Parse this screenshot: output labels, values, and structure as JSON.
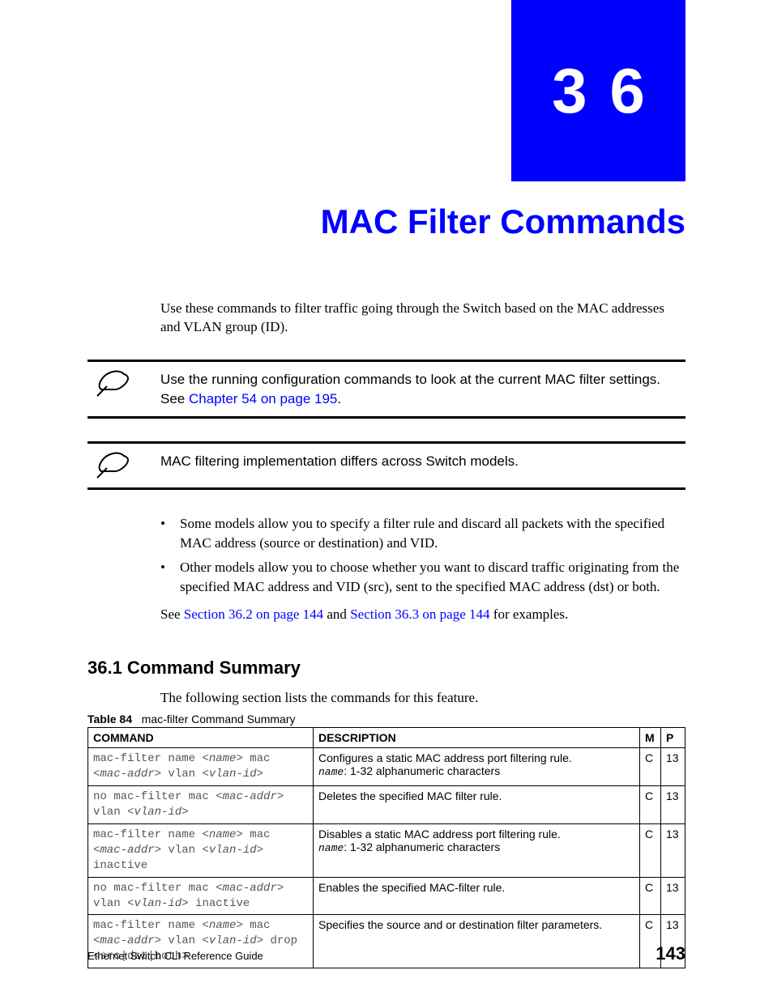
{
  "chapter": {
    "number": "36",
    "title": "MAC Filter Commands"
  },
  "intro": "Use these commands to filter traffic going through the Switch based on the MAC addresses and VLAN group (ID).",
  "note1": {
    "text_before_link": "Use the running configuration commands to look at the current MAC filter settings. See ",
    "link": "Chapter 54 on page 195",
    "text_after_link": "."
  },
  "note2": {
    "text": "MAC filtering implementation differs across Switch models."
  },
  "bullets": [
    "Some models allow you to specify a filter rule and discard all packets with the specified MAC address (source or destination) and VID.",
    "Other models allow you to choose whether you want to discard traffic originating from the specified MAC address and VID (src), sent to the specified MAC address (dst) or both."
  ],
  "see": {
    "pre": "See ",
    "link1": "Section 36.2 on page 144",
    "mid": " and ",
    "link2": "Section 36.3 on page 144",
    "post": " for examples."
  },
  "section": {
    "heading": "36.1  Command Summary",
    "lead": "The following section lists the commands for this feature."
  },
  "table": {
    "caption_label": "Table 84",
    "caption_text": "mac-filter Command Summary",
    "headers": {
      "c1": "COMMAND",
      "c2": "DESCRIPTION",
      "c3": "M",
      "c4": "P"
    },
    "rows": [
      {
        "cmd_html": "mac-filter name <<i>name</i>> mac <<i>mac-addr</i>> vlan <<i>vlan-id</i>>",
        "desc_html": "Configures a static MAC address port filtering rule.<br><span class=\"desc-name\">name</span>: 1-32 alphanumeric characters",
        "m": "C",
        "p": "13"
      },
      {
        "cmd_html": "no mac-filter mac <<i>mac-addr</i>> vlan <<i>vlan-id</i>>",
        "desc_html": "Deletes the specified MAC filter rule.",
        "m": "C",
        "p": "13"
      },
      {
        "cmd_html": "mac-filter name <<i>name</i>> mac <<i>mac-addr</i>> vlan <<i>vlan-id</i>> inactive",
        "desc_html": "Disables a static MAC address port filtering rule.<br><span class=\"desc-name\">name</span>: 1-32 alphanumeric characters",
        "m": "C",
        "p": "13"
      },
      {
        "cmd_html": "no mac-filter mac <<i>mac-addr</i>> vlan <<i>vlan-id</i>> inactive",
        "desc_html": "Enables the specified MAC-filter rule.",
        "m": "C",
        "p": "13"
      },
      {
        "cmd_html": "mac-filter name <<i>name</i>> mac <<i>mac-addr</i>> vlan <<i>vlan-id</i>> drop <src|dst|both>",
        "desc_html": "Specifies the source and or destination filter parameters.",
        "m": "C",
        "p": "13"
      }
    ]
  },
  "footer": {
    "text": "Ethernet Switch CLI Reference Guide",
    "page": "143"
  }
}
